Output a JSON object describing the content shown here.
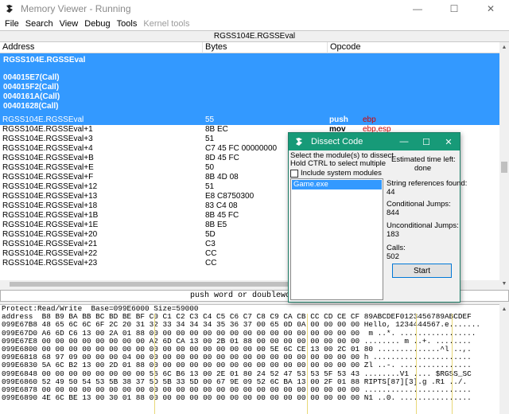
{
  "window": {
    "title": "Memory Viewer - Running",
    "minimize": "—",
    "maximize": "☐",
    "close": "✕"
  },
  "menu": [
    "File",
    "Search",
    "View",
    "Debug",
    "Tools",
    "Kernel tools"
  ],
  "disasm": {
    "title": "RGSS104E.RGSSEval",
    "headers": {
      "address": "Address",
      "bytes": "Bytes",
      "opcode": "Opcode"
    },
    "refs": {
      "label": "RGSS104E.RGSSEval",
      "calls": [
        "004015E7(Call)",
        "004015F2(Call)",
        "0040161A(Call)",
        "00401628(Call)"
      ]
    },
    "rows": [
      {
        "addr": "RGSS104E.RGSSEval",
        "bytes": "55",
        "op": "push",
        "arg": "ebp",
        "selected": true
      },
      {
        "addr": "RGSS104E.RGSSEval+1",
        "bytes": "8B EC",
        "op": "mov",
        "arg": "ebp,esp"
      },
      {
        "addr": "RGSS104E.RGSSEval+3",
        "bytes": "51",
        "op": "",
        "arg": ""
      },
      {
        "addr": "RGSS104E.RGSSEval+4",
        "bytes": "C7 45 FC 00000000",
        "op": "",
        "arg": ""
      },
      {
        "addr": "RGSS104E.RGSSEval+B",
        "bytes": "8D 45 FC",
        "op": "",
        "arg": ""
      },
      {
        "addr": "RGSS104E.RGSSEval+E",
        "bytes": "50",
        "op": "",
        "arg": ""
      },
      {
        "addr": "RGSS104E.RGSSEval+F",
        "bytes": "8B 4D 08",
        "op": "",
        "arg": ""
      },
      {
        "addr": "RGSS104E.RGSSEval+12",
        "bytes": "51",
        "op": "",
        "arg": ""
      },
      {
        "addr": "RGSS104E.RGSSEval+13",
        "bytes": "E8 C8750300",
        "op": "",
        "arg": ""
      },
      {
        "addr": "RGSS104E.RGSSEval+18",
        "bytes": "83 C4 08",
        "op": "",
        "arg": ""
      },
      {
        "addr": "RGSS104E.RGSSEval+1B",
        "bytes": "8B 45 FC",
        "op": "",
        "arg": ""
      },
      {
        "addr": "RGSS104E.RGSSEval+1E",
        "bytes": "8B E5",
        "op": "",
        "arg": ""
      },
      {
        "addr": "RGSS104E.RGSSEval+20",
        "bytes": "5D",
        "op": "",
        "arg": ""
      },
      {
        "addr": "RGSS104E.RGSSEval+21",
        "bytes": "C3",
        "op": "",
        "arg": ""
      },
      {
        "addr": "RGSS104E.RGSSEval+22",
        "bytes": "CC",
        "op": "",
        "arg": ""
      },
      {
        "addr": "RGSS104E.RGSSEval+23",
        "bytes": "CC",
        "op": "",
        "arg": ""
      }
    ]
  },
  "status": "push word or doubleword ont",
  "hex": {
    "info": "Protect:Read/Write  Base=099E6000 Size=59000",
    "header": "address  B8 B9 BA BB BC BD BE BF C0 C1 C2 C3 C4 C5 C6 C7 C8 C9 CA CB CC CD CE CF 89ABCDEF0123456789ABCDEF",
    "lines": [
      "099E67B8 48 65 6C 6C 6F 2C 20 31 32 33 34 34 34 35 36 37 00 65 0D 0A 00 00 00 00 Hello, 1234444567.e.......",
      "099E67D0 A6 6D C6 13 00 2A 01 88 00 00 00 00 00 00 00 00 00 00 00 00 00 00 00 00  m ..*. .................",
      "099E67E8 00 00 00 00 00 00 00 00 A2 6D CA 13 00 2B 01 88 00 00 00 00 00 00 00 00 ........ m ..+. ........",
      "099E6800 00 00 00 00 00 00 00 00 00 00 00 00 00 00 00 00 00 5E 6C CE 13 00 2C 01 80 ..............^l ..,.",
      "099E6818 68 97 09 00 00 00 04 00 00 00 00 00 00 00 00 00 00 00 00 00 00 00 00 00 h ......................",
      "099E6830 5A 6C B2 13 00 2D 01 88 00 00 00 00 00 00 00 00 00 00 00 00 00 00 00 00 Zl ..-. ................",
      "099E6848 00 00 00 00 00 00 00 00 56 6C B6 13 00 2E 01 80 24 52 47 53 53 5F 53 43 ........V1 .... $RGSS_SC",
      "099E6860 52 49 50 54 53 5B 38 37 5D 5B 33 5D 00 67 9E 09 52 6C BA 13 00 2F 01 88 RIPTS[87][3].g .R1 ../.",
      "099E6878 00 00 00 00 00 00 00 00 00 00 00 00 00 00 00 00 00 00 00 00 00 00 00 00 ........................",
      "099E6890 4E 6C BE 13 00 30 01 88 00 00 00 00 00 00 00 00 00 00 00 00 00 00 00 00 N1 ..0. ................"
    ]
  },
  "dialog": {
    "title": "Dissect Code",
    "instr1": "Select the module(s) to dissect",
    "instr2": "Hold CTRL to select multiple",
    "include_system": "Include system modules",
    "modules": [
      "Game.exe"
    ],
    "estimated_label": "Estimated time left:",
    "estimated_value": "done",
    "string_refs_label": "String references found:",
    "string_refs_value": "44",
    "cond_label": "Conditional Jumps:",
    "cond_value": "844",
    "uncond_label": "Unconditional Jumps:",
    "uncond_value": "183",
    "calls_label": "Calls:",
    "calls_value": "502",
    "start_label": "Start"
  }
}
